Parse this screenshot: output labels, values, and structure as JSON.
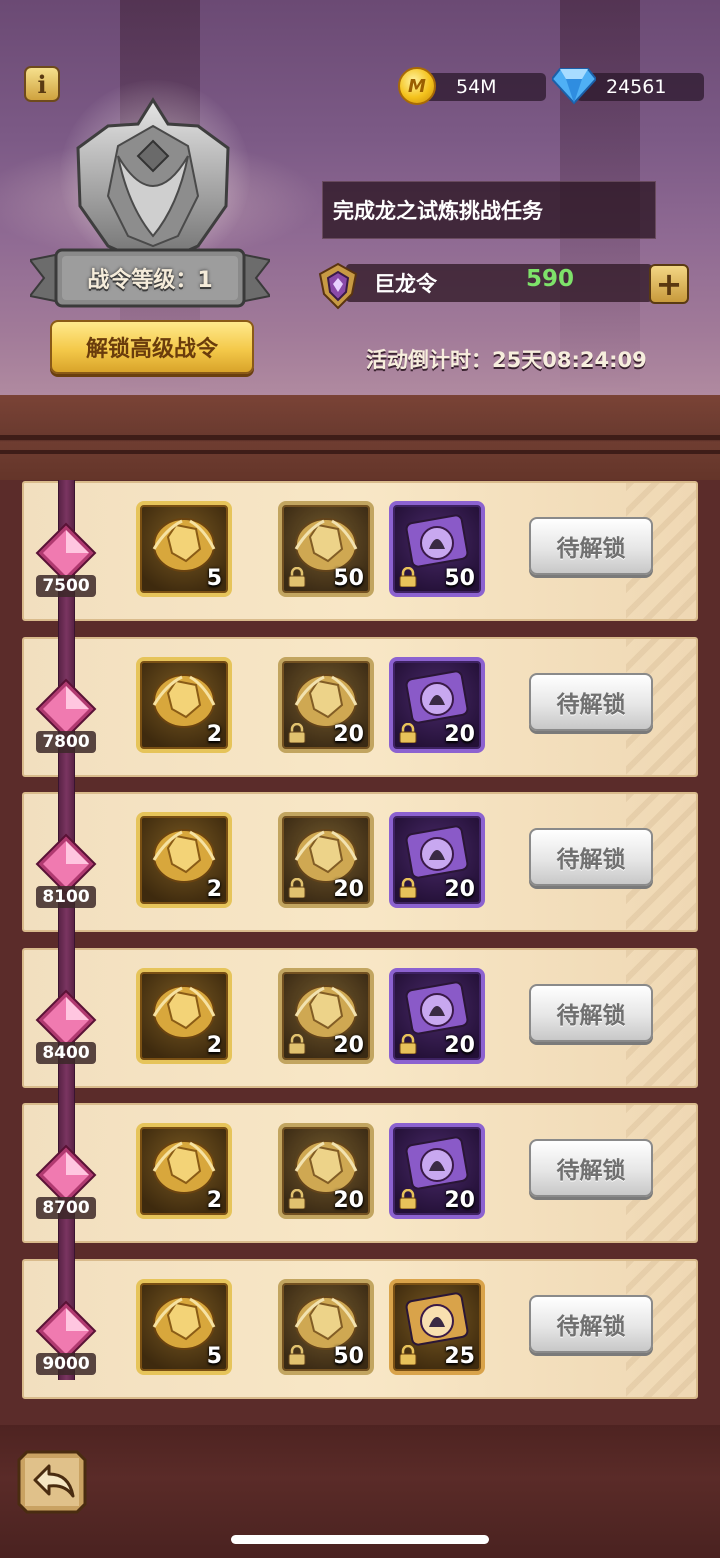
{
  "header": {
    "info_icon": "info-icon",
    "rank_label": "战令等级：1",
    "unlock_button": "解锁高级战令",
    "currency": {
      "coins_icon": "coin-icon",
      "coins_letter": "M",
      "coins": "54M",
      "gems_icon": "diamond-icon",
      "gems": "24561"
    },
    "task_text": "完成龙之试炼挑战任务",
    "token": {
      "icon": "dragon-token-icon",
      "label": "巨龙令",
      "value": "590",
      "value_color": "#7ee26a",
      "add_icon": "plus-icon",
      "add_symbol": "+"
    },
    "countdown": "活动倒计时：25天08:24:09"
  },
  "rows": [
    {
      "milestone": "7500",
      "free_count": "5",
      "premium_count": "50",
      "third_count": "50",
      "third_type": "purple",
      "button": "待解锁"
    },
    {
      "milestone": "7800",
      "free_count": "2",
      "premium_count": "20",
      "third_count": "20",
      "third_type": "purple",
      "button": "待解锁"
    },
    {
      "milestone": "8100",
      "free_count": "2",
      "premium_count": "20",
      "third_count": "20",
      "third_type": "purple",
      "button": "待解锁"
    },
    {
      "milestone": "8400",
      "free_count": "2",
      "premium_count": "20",
      "third_count": "20",
      "third_type": "purple",
      "button": "待解锁"
    },
    {
      "milestone": "8700",
      "free_count": "2",
      "premium_count": "20",
      "third_count": "20",
      "third_type": "purple",
      "button": "待解锁"
    },
    {
      "milestone": "9000",
      "free_count": "5",
      "premium_count": "50",
      "third_count": "25",
      "third_type": "orange",
      "button": "待解锁"
    }
  ],
  "footer": {
    "back_icon": "back-arrow-icon"
  },
  "colors": {
    "accent_gold": "#f4c94a",
    "purple_frame": "#8c62d0",
    "gold_frame": "#e6c45a"
  }
}
